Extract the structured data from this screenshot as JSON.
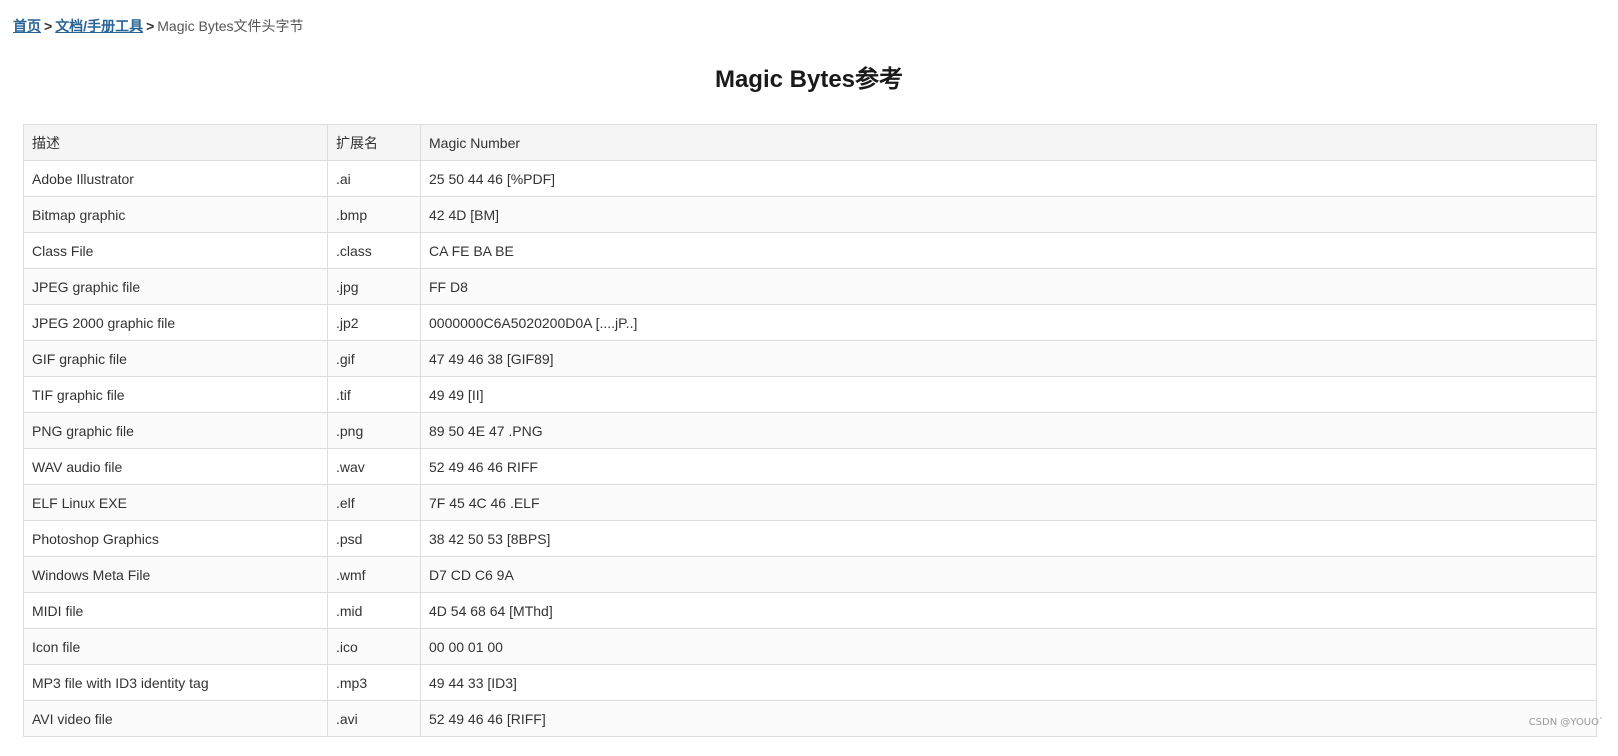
{
  "breadcrumb": {
    "home": "首页",
    "separator": ">",
    "docs": "文档/手册工具",
    "current": "Magic Bytes文件头字节"
  },
  "page": {
    "title": "Magic Bytes参考"
  },
  "table": {
    "headers": [
      "描述",
      "扩展名",
      "Magic Number"
    ],
    "rows": [
      [
        "Adobe Illustrator",
        ".ai",
        "25 50 44 46 [%PDF]"
      ],
      [
        "Bitmap graphic",
        ".bmp",
        "42 4D [BM]"
      ],
      [
        "Class File",
        ".class",
        "CA FE BA BE"
      ],
      [
        "JPEG graphic file",
        ".jpg",
        "FF D8"
      ],
      [
        "JPEG 2000 graphic file",
        ".jp2",
        "0000000C6A5020200D0A [....jP..]"
      ],
      [
        "GIF graphic file",
        ".gif",
        "47 49 46 38 [GIF89]"
      ],
      [
        "TIF graphic file",
        ".tif",
        "49 49 [II]"
      ],
      [
        "PNG graphic file",
        ".png",
        "89 50 4E 47 .PNG"
      ],
      [
        "WAV audio file",
        ".wav",
        "52 49 46 46 RIFF"
      ],
      [
        "ELF Linux EXE",
        ".elf",
        "7F 45 4C 46 .ELF"
      ],
      [
        "Photoshop Graphics",
        ".psd",
        "38 42 50 53 [8BPS]"
      ],
      [
        "Windows Meta File",
        ".wmf",
        "D7 CD C6 9A"
      ],
      [
        "MIDI file",
        ".mid",
        "4D 54 68 64 [MThd]"
      ],
      [
        "Icon file",
        ".ico",
        "00 00 01 00"
      ],
      [
        "MP3 file with ID3 identity tag",
        ".mp3",
        "49 44 33 [ID3]"
      ],
      [
        "AVI video file",
        ".avi",
        "52 49 46 46 [RIFF]"
      ]
    ]
  },
  "watermark": "CSDN @YOUO`"
}
